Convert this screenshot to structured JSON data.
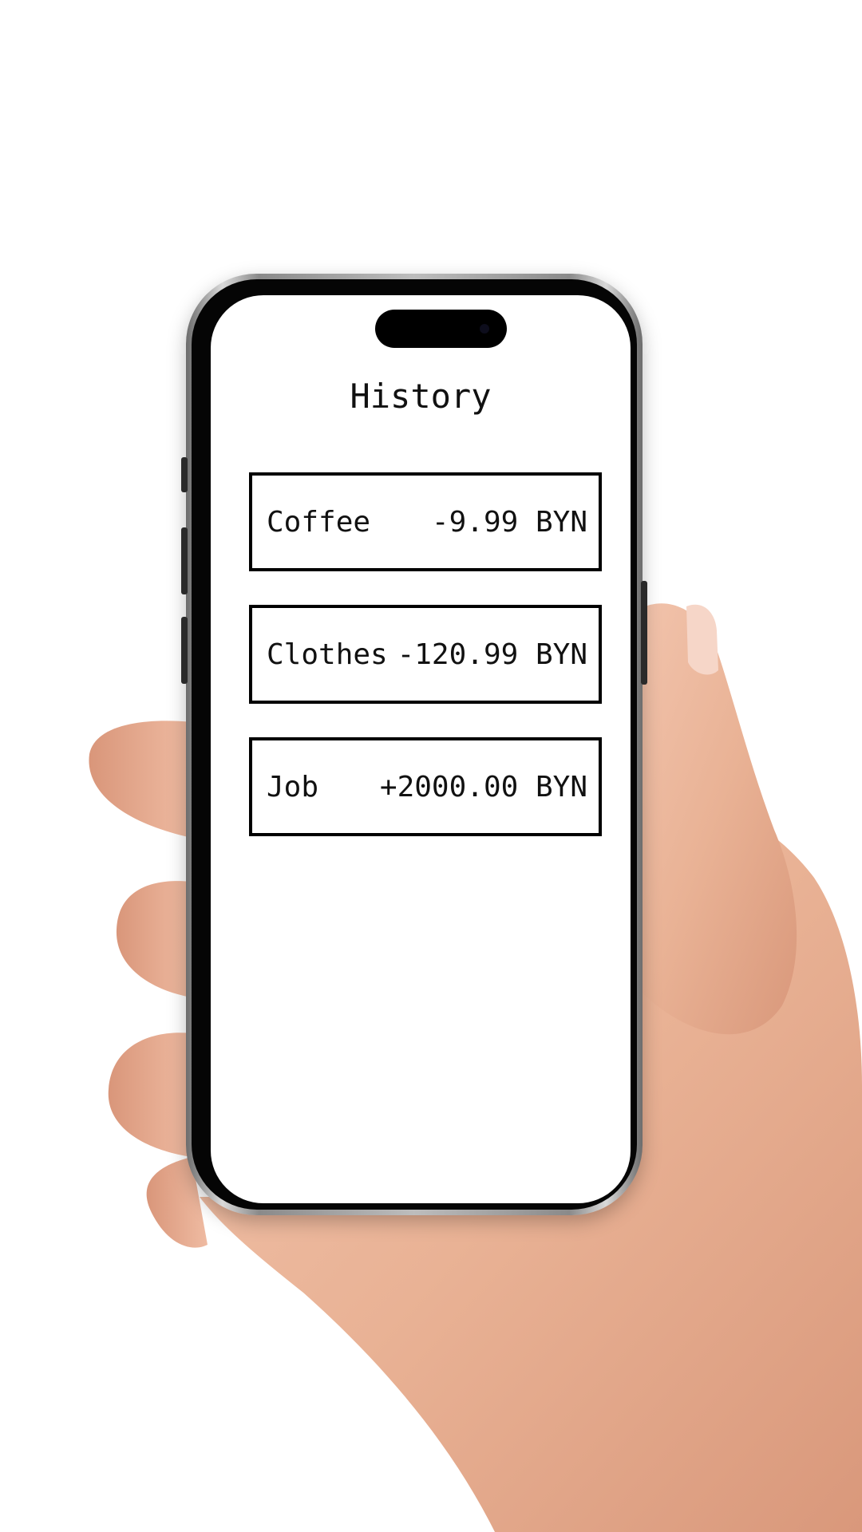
{
  "screen": {
    "title": "History"
  },
  "transactions": [
    {
      "name": "Coffee",
      "amount": "-9.99 BYN"
    },
    {
      "name": "Clothes",
      "amount": "-120.99 BYN"
    },
    {
      "name": "Job",
      "amount": "+2000.00 BYN"
    }
  ]
}
